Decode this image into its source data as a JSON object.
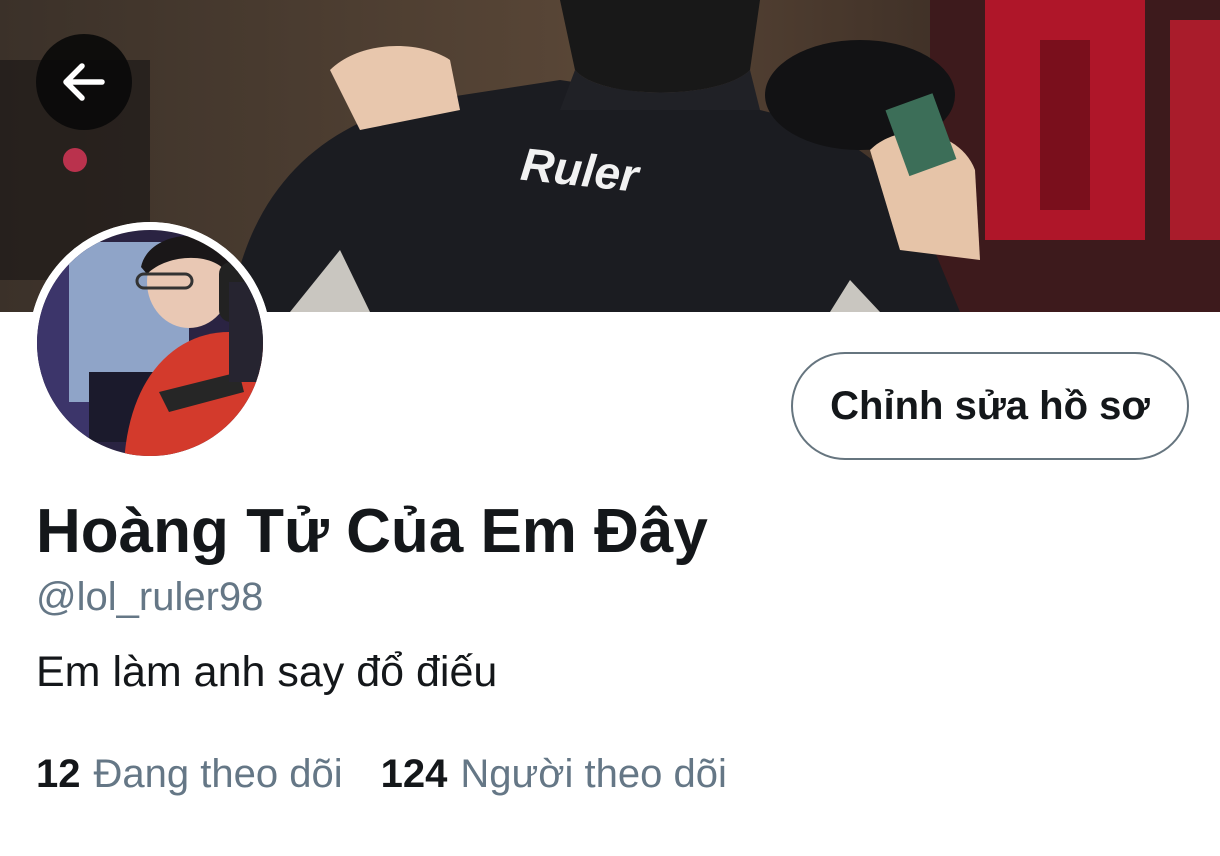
{
  "header": {
    "back_icon": "arrow-left-icon",
    "banner_jersey_text": "Ruler"
  },
  "profile": {
    "edit_button_label": "Chỉnh sửa hồ sơ",
    "display_name": "Hoàng Tử Của Em Đây",
    "handle": "@lol_ruler98",
    "bio": "Em làm anh say đổ điếu"
  },
  "stats": {
    "following_count": "12",
    "following_label": "Đang theo dõi",
    "followers_count": "124",
    "followers_label": "Người theo dõi"
  },
  "colors": {
    "primary_text": "#14171a",
    "secondary_text": "#657786",
    "button_border": "#66757f",
    "background": "#ffffff"
  }
}
